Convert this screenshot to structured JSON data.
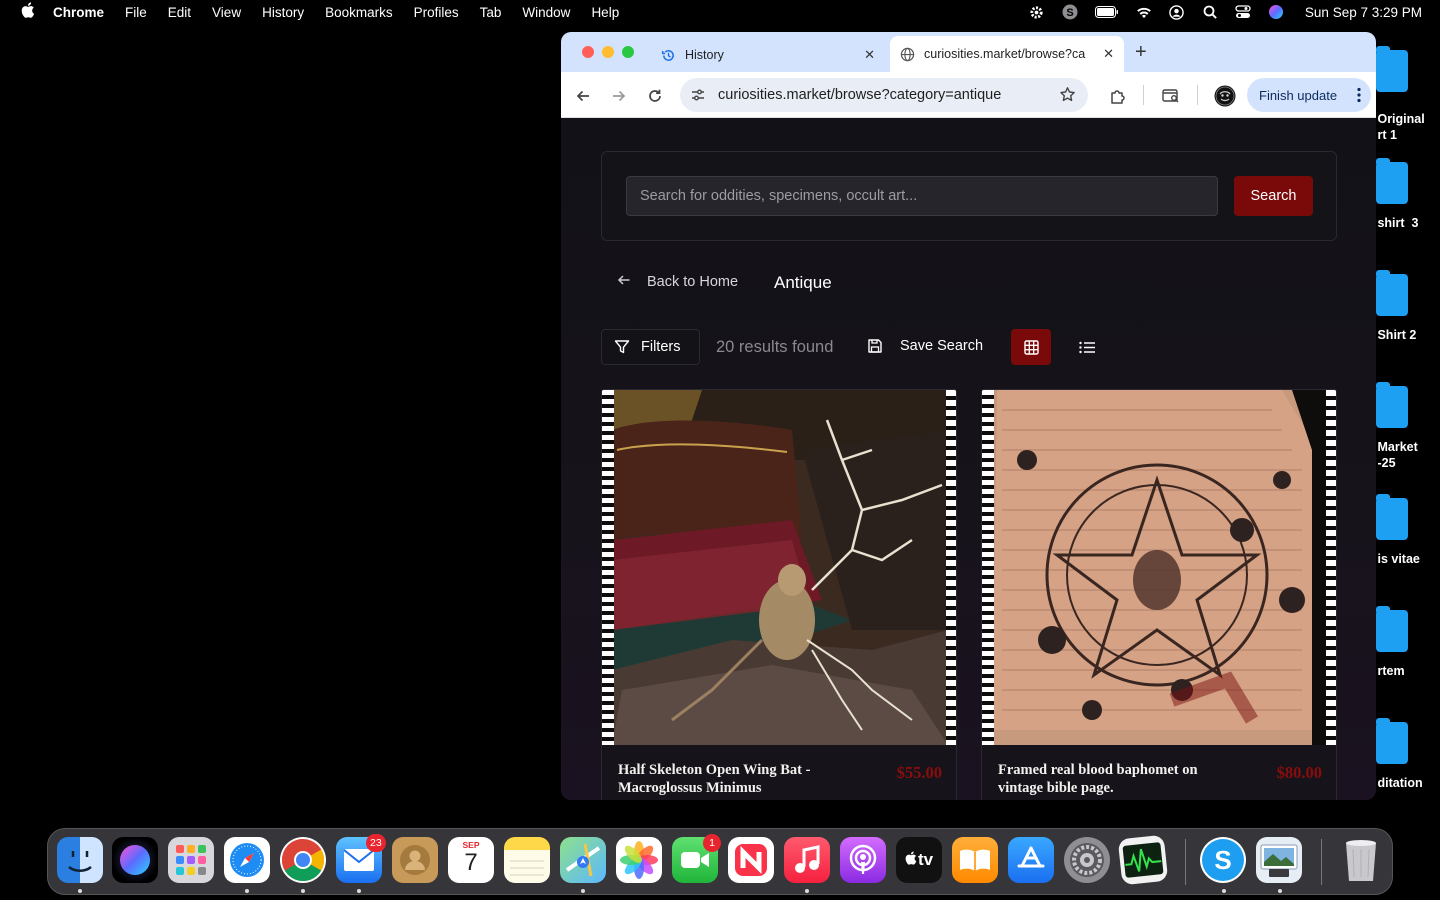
{
  "menubar": {
    "app_name": "Chrome",
    "items": [
      "File",
      "Edit",
      "View",
      "History",
      "Bookmarks",
      "Profiles",
      "Tab",
      "Window",
      "Help"
    ],
    "clock": "Sun Sep 7  3:29 PM"
  },
  "desktop": {
    "items": [
      {
        "label": " Original\n rt 1"
      },
      {
        "label": " shirt  3"
      },
      {
        "label": " Shirt 2"
      },
      {
        "label": " Market\n -25"
      },
      {
        "label": " is vitae"
      },
      {
        "label": " rtem"
      },
      {
        "label": " ditation"
      }
    ]
  },
  "browser": {
    "tabs": [
      {
        "title": "History",
        "icon": "history-icon"
      },
      {
        "title": "curiosities.market/browse?ca",
        "icon": "globe-icon"
      }
    ],
    "url": "curiosities.market/browse?category=antique",
    "finish_update_label": "Finish update"
  },
  "page": {
    "search": {
      "placeholder": "Search for oddities, specimens, occult art...",
      "button_label": "Search"
    },
    "back_label": "Back to Home",
    "category_title": "Antique",
    "filters_label": "Filters",
    "results_text": "20 results found",
    "save_search_label": "Save Search",
    "view_mode": "grid",
    "accent_color": "#7a0a0a",
    "products": [
      {
        "title": "Half Skeleton Open Wing Bat - Macroglossus Minimus",
        "price": "$55.00"
      },
      {
        "title": "Framed real blood baphomet on vintage bible page.",
        "price": "$80.00"
      }
    ]
  },
  "dock": {
    "apps": [
      "Finder",
      "Siri",
      "Launchpad",
      "Safari",
      "Chrome",
      "Mail",
      "Contacts",
      "Calendar",
      "Notes",
      "Maps",
      "Photos",
      "FaceTime",
      "News",
      "Music",
      "Podcasts",
      "TV",
      "Books",
      "App Store",
      "System Settings",
      "Activity Monitor",
      "Skype",
      "Preview",
      "Trash"
    ],
    "calendar_month": "SEP",
    "calendar_day": "7",
    "mail_badge": "23",
    "facetime_badge": "1",
    "tv_label": "tv"
  }
}
